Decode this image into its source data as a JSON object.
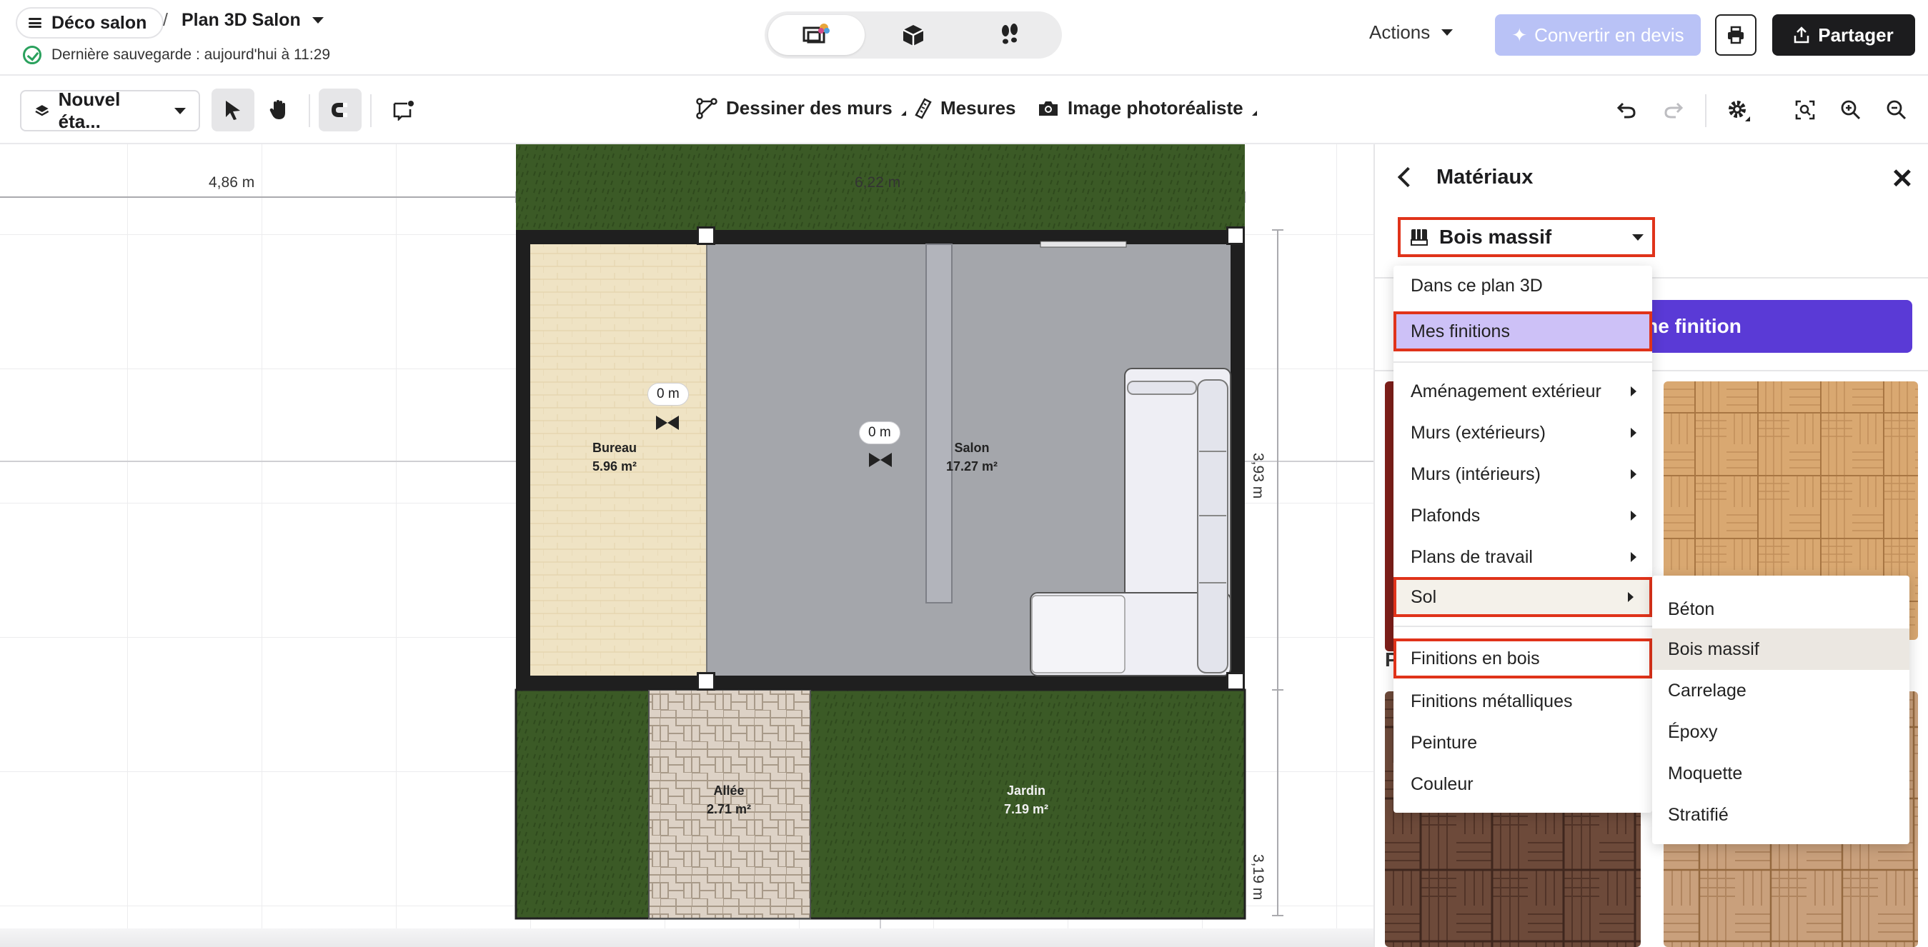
{
  "header": {
    "project_name": "Déco salon",
    "separator": "/",
    "plan_name": "Plan 3D Salon",
    "save_status": "Dernière sauvegarde : aujourd'hui à 11:29",
    "actions_label": "Actions",
    "convert_label": "Convertir en devis",
    "share_label": "Partager"
  },
  "toolbar": {
    "floor_label": "Nouvel éta...",
    "draw_walls_label": "Dessiner des murs",
    "measures_label": "Mesures",
    "photo_label": "Image photoréaliste"
  },
  "canvas": {
    "dimensions": {
      "left_width": "4,86 m",
      "top_width": "6,22 m",
      "right_top": "3,93 m",
      "right_bottom": "3,19 m"
    },
    "rooms": [
      {
        "name": "Bureau",
        "area": "5.96 m²"
      },
      {
        "name": "Salon",
        "area": "17.27 m²"
      },
      {
        "name": "Allée",
        "area": "2.71 m²"
      },
      {
        "name": "Jardin",
        "area": "7.19 m²"
      }
    ],
    "height_labels": [
      "0 m",
      "0 m"
    ]
  },
  "panel": {
    "title": "Matériaux",
    "selected_material": "Bois massif",
    "add_finish_label": "une finition",
    "partial_heading": "P"
  },
  "menu": {
    "top_items": [
      "Dans ce plan 3D",
      "Mes finitions"
    ],
    "categories": [
      {
        "label": "Aménagement extérieur"
      },
      {
        "label": "Murs (extérieurs)"
      },
      {
        "label": "Murs (intérieurs)"
      },
      {
        "label": "Plafonds"
      },
      {
        "label": "Plans de travail"
      },
      {
        "label": "Sol"
      }
    ],
    "bottom_items": [
      "Finitions en bois",
      "Finitions métalliques",
      "Peinture",
      "Couleur"
    ]
  },
  "submenu": {
    "items": [
      "Béton",
      "Bois massif",
      "Carrelage",
      "Époxy",
      "Moquette",
      "Stratifié"
    ],
    "selected": "Bois massif"
  },
  "colors": {
    "accent": "#5a3ad6",
    "highlight_outline": "#e0331a",
    "menu_highlight": "#cdc1f7",
    "convert_disabled": "#b9c2f6",
    "grass": "#3b5a26",
    "salon_floor": "#a4a6ab",
    "bureau_floor": "#efe3c4"
  }
}
